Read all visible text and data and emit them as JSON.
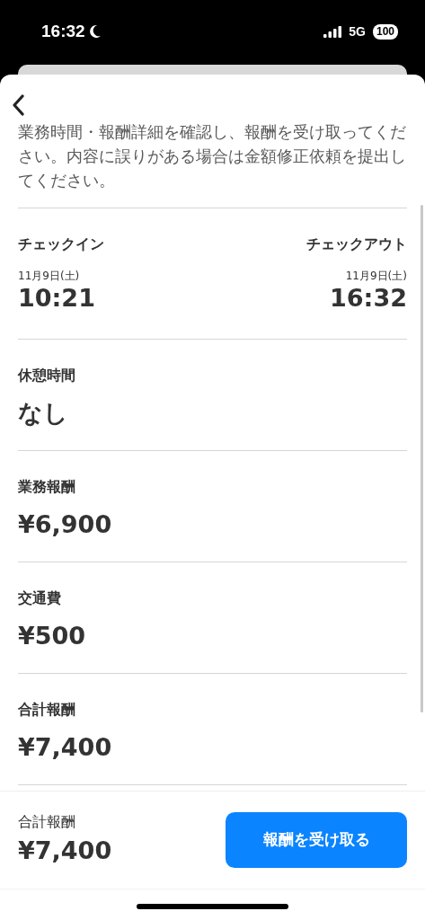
{
  "status_bar": {
    "time": "16:32",
    "network": "5G",
    "battery": "100"
  },
  "description": "業務時間・報酬詳細を確認し、報酬を受け取ってください。内容に誤りがある場合は金額修正依頼を提出してください。",
  "check_in": {
    "label": "チェックイン",
    "date": "11月9日(土)",
    "time": "10:21"
  },
  "check_out": {
    "label": "チェックアウト",
    "date": "11月9日(土)",
    "time": "16:32"
  },
  "items": [
    {
      "label": "休憩時間",
      "value": "なし"
    },
    {
      "label": "業務報酬",
      "value": "¥6,900"
    },
    {
      "label": "交通費",
      "value": "¥500"
    },
    {
      "label": "合計報酬",
      "value": "¥7,400"
    }
  ],
  "footer": {
    "label": "合計報酬",
    "value": "¥7,400",
    "button": "報酬を受け取る"
  }
}
